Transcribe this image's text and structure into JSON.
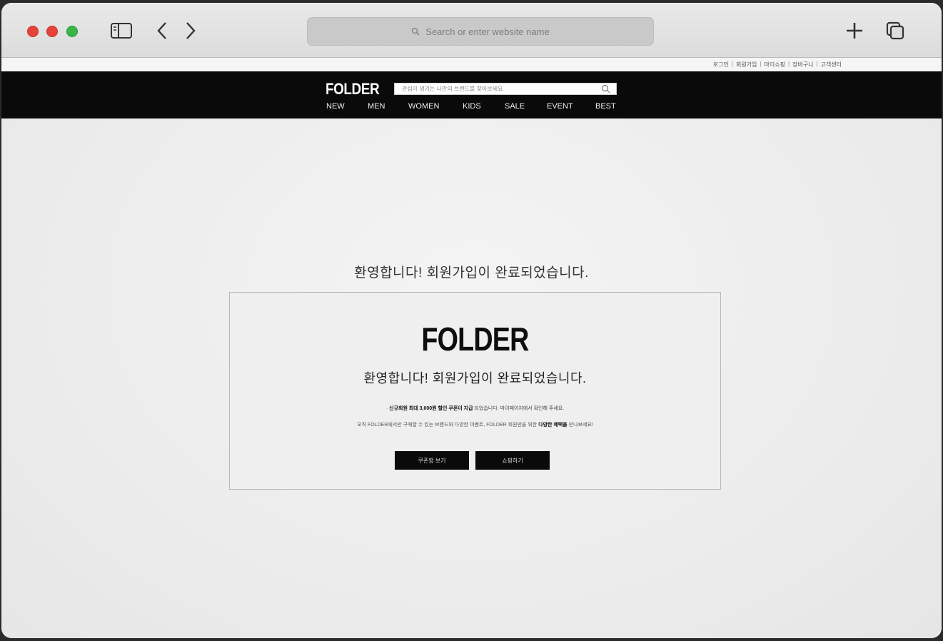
{
  "browser": {
    "url_placeholder": "Search or enter website name"
  },
  "util_bar": {
    "links": [
      "로그인",
      "회원가입",
      "마이쇼핑",
      "장바구니",
      "고객센터"
    ]
  },
  "gnb": {
    "logo": "FOLDER",
    "search_placeholder": "관심이 생기는 나만의 브랜드를 찾아보세요",
    "nav": [
      "NEW",
      "MEN",
      "WOMEN",
      "KIDS",
      "SALE",
      "EVENT",
      "BEST"
    ]
  },
  "main": {
    "welcome_heading": "환영합니다! 회원가입이 완료되었습니다.",
    "card": {
      "logo": "FOLDER",
      "title": "환영합니다! 회원가입이 완료되었습니다.",
      "note1_bold": "신규회원 최대 3,000원 할인 쿠폰이 지급",
      "note1_rest": "되었습니다. 마이페이지에서 확인해 주세요.",
      "note2_rest": "오직 FOLDER에서만 구매할 수 있는 브랜드와 다양한 이벤트, FOLDER 회원만을 위한",
      "note2_bold": "다양한 혜택을",
      "note2_end": "만나보세요!",
      "coupon_button": "쿠폰함 보기",
      "shop_button": "쇼핑하기"
    }
  }
}
